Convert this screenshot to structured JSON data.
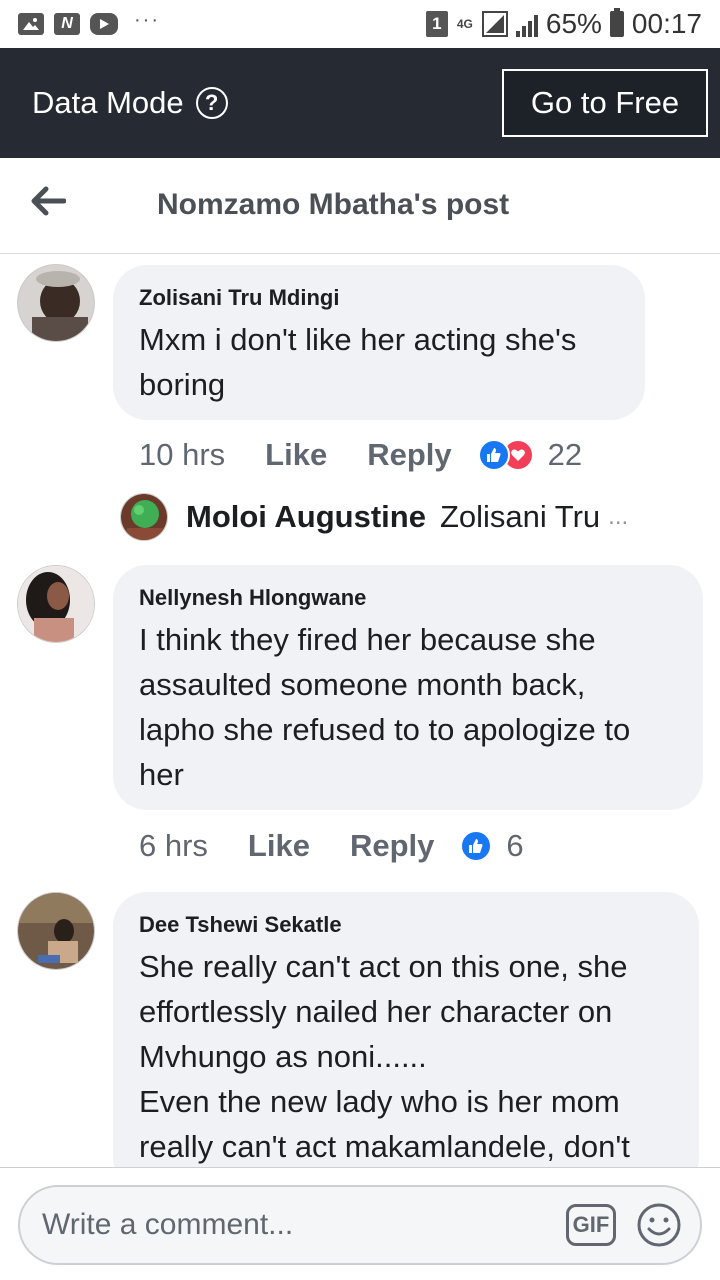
{
  "status_bar": {
    "notification_icons": [
      "image-icon",
      "n-app-icon",
      "youtube-icon"
    ],
    "more_dots": "···",
    "sim_slot": "1",
    "network": "4G",
    "battery": "65%",
    "time": "00:17"
  },
  "data_bar": {
    "label": "Data Mode",
    "help": "?",
    "go_free_label": "Go to Free"
  },
  "header": {
    "title": "Nomzamo Mbatha's post"
  },
  "comments": [
    {
      "author": "Zolisani Tru Mdingi",
      "text": "Mxm i don't like her acting she's\nboring",
      "time": "10 hrs",
      "like_label": "Like",
      "reply_label": "Reply",
      "reactions": [
        "like",
        "love"
      ],
      "reaction_count": "22",
      "reply_preview": {
        "author": "Moloi Augustine",
        "text": "Zolisani Tru",
        "ellipsis": "..."
      }
    },
    {
      "author": "Nellynesh Hlongwane",
      "text": "I think they fired her because she\nassaulted someone month back,\nlapho she refused to to apologize to\nher",
      "time": "6 hrs",
      "like_label": "Like",
      "reply_label": "Reply",
      "reactions": [
        "like"
      ],
      "reaction_count": "6"
    },
    {
      "author": "Dee Tshewi Sekatle",
      "text": "She really can't act on this one, she\neffortlessly nailed her character on\nMvhungo as noni......\nEven the new lady who is her mom\nreally can't act makamlandele, don't"
    }
  ],
  "composer": {
    "placeholder": "Write a comment...",
    "gif_label": "GIF"
  },
  "colors": {
    "data_bar_bg": "#252a33",
    "bubble_bg": "#f0f2f5",
    "like_blue": "#1877f2",
    "love_red": "#f33e58",
    "secondary_text": "#606770"
  }
}
